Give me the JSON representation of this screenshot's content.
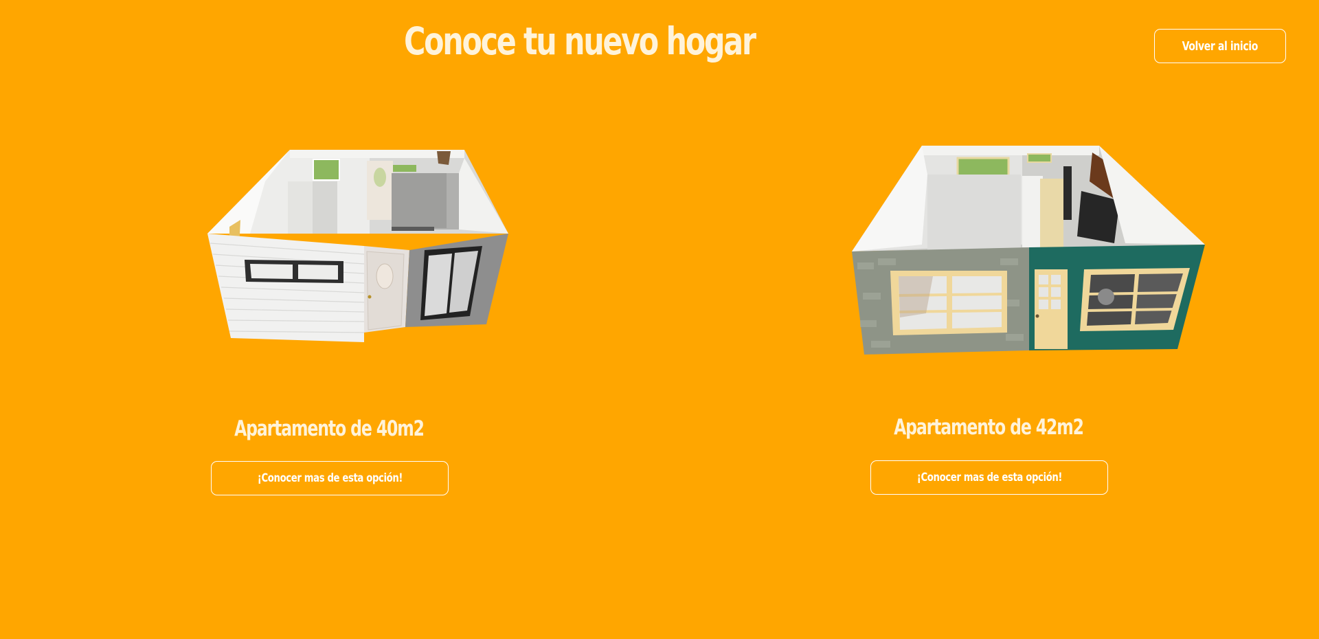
{
  "header": {
    "title": "Conoce tu nuevo hogar",
    "back_label": "Volver al inicio"
  },
  "options": [
    {
      "title": "Apartamento de 40m2",
      "button_label": "¡Conocer mas de esta opción!"
    },
    {
      "title": "Apartamento de 42m2",
      "button_label": "¡Conocer mas de esta opción!"
    }
  ],
  "colors": {
    "background": "#FFA600",
    "title_text": "#FFF3DA",
    "button_border": "#FFFFFF"
  },
  "icons": {
    "house_1": "apartment-40m2-3d-render",
    "house_2": "apartment-42m2-3d-render"
  }
}
